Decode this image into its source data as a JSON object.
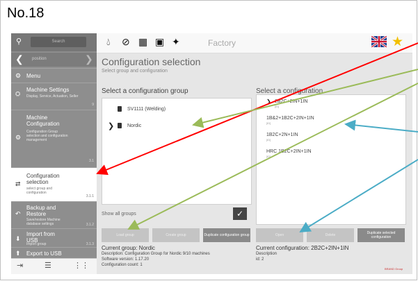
{
  "slide_label": "No.18",
  "search": {
    "placeholder": "Search"
  },
  "sidebar": {
    "back_label": "position",
    "items": [
      {
        "icon": "gear-icon",
        "title": "Menu",
        "sub": "",
        "num": ""
      },
      {
        "icon": "machine-icon",
        "title": "Machine Settings",
        "sub": "Display, Service, Actuation, Seller",
        "num": "9"
      },
      {
        "icon": "gear-icon",
        "title": "Machine Configuration",
        "sub": "Configuration Group selection and configuration management",
        "num": "3.1"
      },
      {
        "icon": "configuration-icon",
        "title": "Configuration selection",
        "sub": "select group and configuration",
        "num": "3.1.1"
      },
      {
        "icon": "backup-icon",
        "title": "Backup and Restore",
        "sub": "Save/restore Machine database settings",
        "num": "3.1.2"
      },
      {
        "icon": "usb-icon",
        "title": "Import from USB",
        "sub": "Import group",
        "num": "3.1.3"
      },
      {
        "icon": "usb-icon",
        "title": "Export to USB",
        "sub": "",
        "num": ""
      }
    ]
  },
  "header": {
    "factory_label": "Factory",
    "page_title": "Configuration selection",
    "page_subtitle": "Select group and configuration"
  },
  "groups": {
    "heading": "Select a configuration group",
    "items": [
      "SV1111 (Welding)",
      "Nordic"
    ]
  },
  "configurations": {
    "heading": "Select a configuration",
    "items": [
      {
        "name": "2B2C+2IN+1IN",
        "sub": "[ID]"
      },
      {
        "name": "1B&2+1B2C+2IN+1IN",
        "sub": "[ID]"
      },
      {
        "name": "1B2C+2N+1IN",
        "sub": "[ID]"
      },
      {
        "name": "HRC 1B2C+2IN+1IN",
        "sub": "[ID]"
      }
    ]
  },
  "show_all_groups_label": "Show all groups",
  "buttons": {
    "load_group": "Load group",
    "create_group": "Create group",
    "duplicate_group": "Duplicate configuration group",
    "open": "Open",
    "delete": "Delete",
    "duplicate_config": "Duplicate selected configuration"
  },
  "info_left": {
    "current_group": "Current group: Nordic",
    "description": "Description: Configuration Group for Nordic 9/10 machines",
    "software_version": "Software version: 1.17.20",
    "config_count": "Configuration count: 1"
  },
  "info_right": {
    "current_config": "Current configuration: 2B2C+2IN+1IN",
    "description_label": "Description",
    "id_value": "id: 2"
  },
  "brand_text": "BRAND Group",
  "colors": {
    "arrow_red": "#ff0000",
    "arrow_green": "#9bbb59",
    "arrow_blue": "#4bacc6",
    "sidebar": "#8e8e8e"
  }
}
